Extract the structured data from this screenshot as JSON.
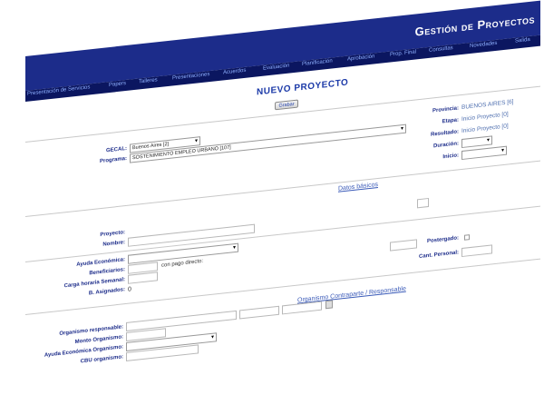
{
  "header": {
    "brand": "Gestión de Proyectos",
    "nav_left": "Presentación de Servicios",
    "nav_items": [
      "Papers",
      "Talleres",
      "Presentaciones",
      "Acuerdos",
      "Evaluación",
      "Planificación",
      "Aprobación",
      "Prop. Final",
      "Consultas",
      "Novedades",
      "Salida"
    ]
  },
  "page": {
    "title": "NUEVO PROYECTO",
    "save_button": "Grabar"
  },
  "top": {
    "gecal_label": "GECAL:",
    "gecal_value": "Buenos Aires [2]",
    "programa_label": "Programa:",
    "programa_value": "SOSTENIMIENTO EMPLEO URBANO [107]",
    "provincia_label": "Provincia:",
    "provincia_value": "BUENOS AIRES [6]",
    "etapa_label": "Etapa:",
    "etapa_value": "Inicio Proyecto [0]",
    "resultado_label": "Resultado:",
    "resultado_value": "Inicio Proyecto [0]",
    "duracion_label": "Duración:",
    "inicio_label": "Inicio:"
  },
  "datos_basicos": {
    "section_title": "Datos básicos",
    "proyecto_label": "Proyecto:",
    "nombre_label": "Nombre:"
  },
  "economia": {
    "ayuda_label": "Ayuda Económica:",
    "beneficiarios_label": "Beneficiarios:",
    "pago_directo_text": "con pago directo:",
    "carga_label": "Carga horaria Semanal:",
    "asignados_label": "B. Asignados:",
    "asignados_value": "0",
    "postergado_label": "Postergado:",
    "cant_personal_label": "Cant. Personal:"
  },
  "contraparte": {
    "section_title": "Organismo Contraparte / Responsable",
    "org_resp_label": "Organismo responsable:",
    "monto_label": "Monto Organismo:",
    "ayuda_org_label": "Ayuda Económica Organismo:",
    "cbu_label": "CBU organismo:"
  },
  "colors": {
    "header_blue": "#1c2c8a",
    "nav_dark": "#0b1660",
    "label_blue": "#1c2c8a",
    "link_blue": "#3a5ab8"
  }
}
